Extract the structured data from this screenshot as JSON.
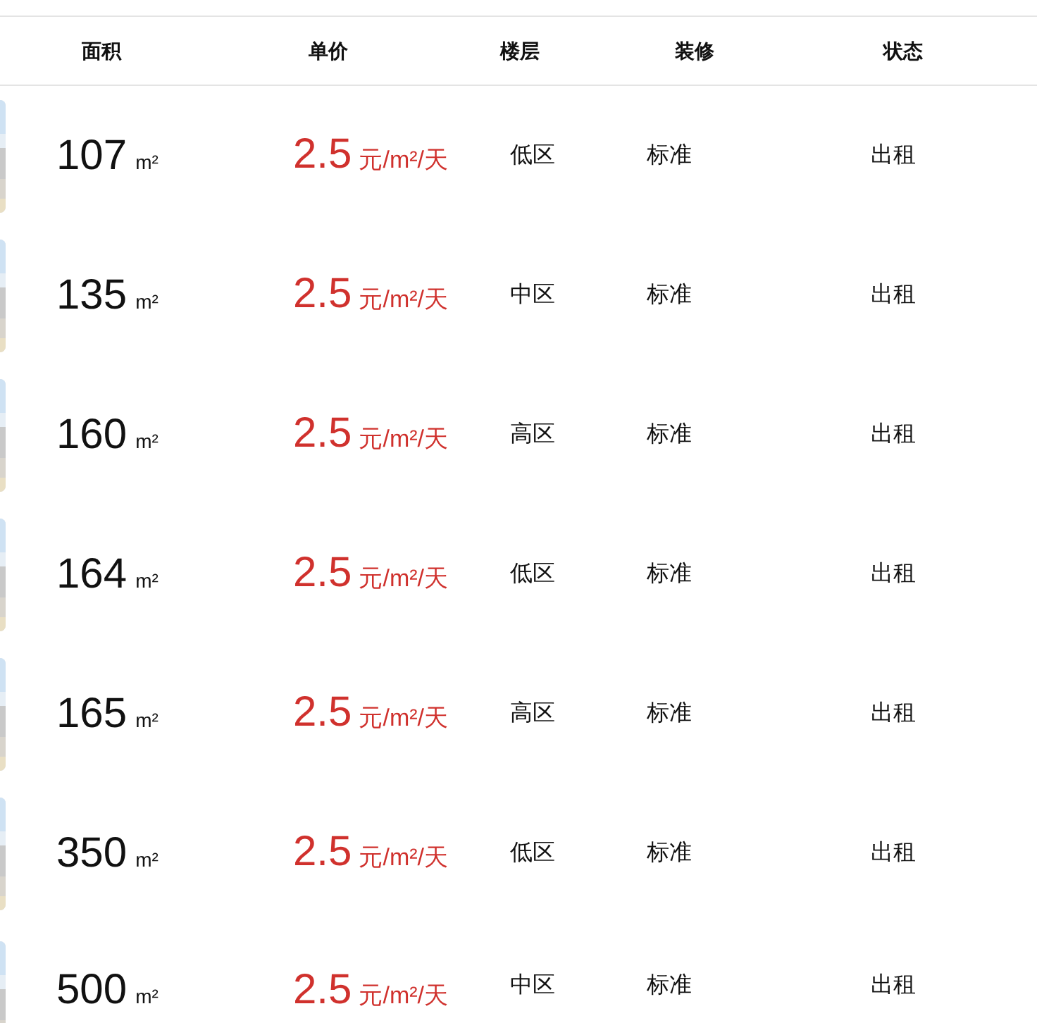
{
  "table": {
    "columns": [
      "面积",
      "单价",
      "楼层",
      "装修",
      "状态"
    ],
    "rows": [
      {
        "area": "107",
        "area_unit": "m²",
        "price": "2.5",
        "price_unit": "元/m²/天",
        "floor": "低区",
        "decoration": "标准",
        "status": "出租"
      },
      {
        "area": "135",
        "area_unit": "m²",
        "price": "2.5",
        "price_unit": "元/m²/天",
        "floor": "中区",
        "decoration": "标准",
        "status": "出租"
      },
      {
        "area": "160",
        "area_unit": "m²",
        "price": "2.5",
        "price_unit": "元/m²/天",
        "floor": "高区",
        "decoration": "标准",
        "status": "出租"
      },
      {
        "area": "164",
        "area_unit": "m²",
        "price": "2.5",
        "price_unit": "元/m²/天",
        "floor": "低区",
        "decoration": "标准",
        "status": "出租"
      },
      {
        "area": "165",
        "area_unit": "m²",
        "price": "2.5",
        "price_unit": "元/m²/天",
        "floor": "高区",
        "decoration": "标准",
        "status": "出租"
      },
      {
        "area": "350",
        "area_unit": "m²",
        "price": "2.5",
        "price_unit": "元/m²/天",
        "floor": "低区",
        "decoration": "标准",
        "status": "出租"
      },
      {
        "area": "500",
        "area_unit": "m²",
        "price": "2.5",
        "price_unit": "元/m²/天",
        "floor": "中区",
        "decoration": "标准",
        "status": "出租"
      }
    ]
  }
}
